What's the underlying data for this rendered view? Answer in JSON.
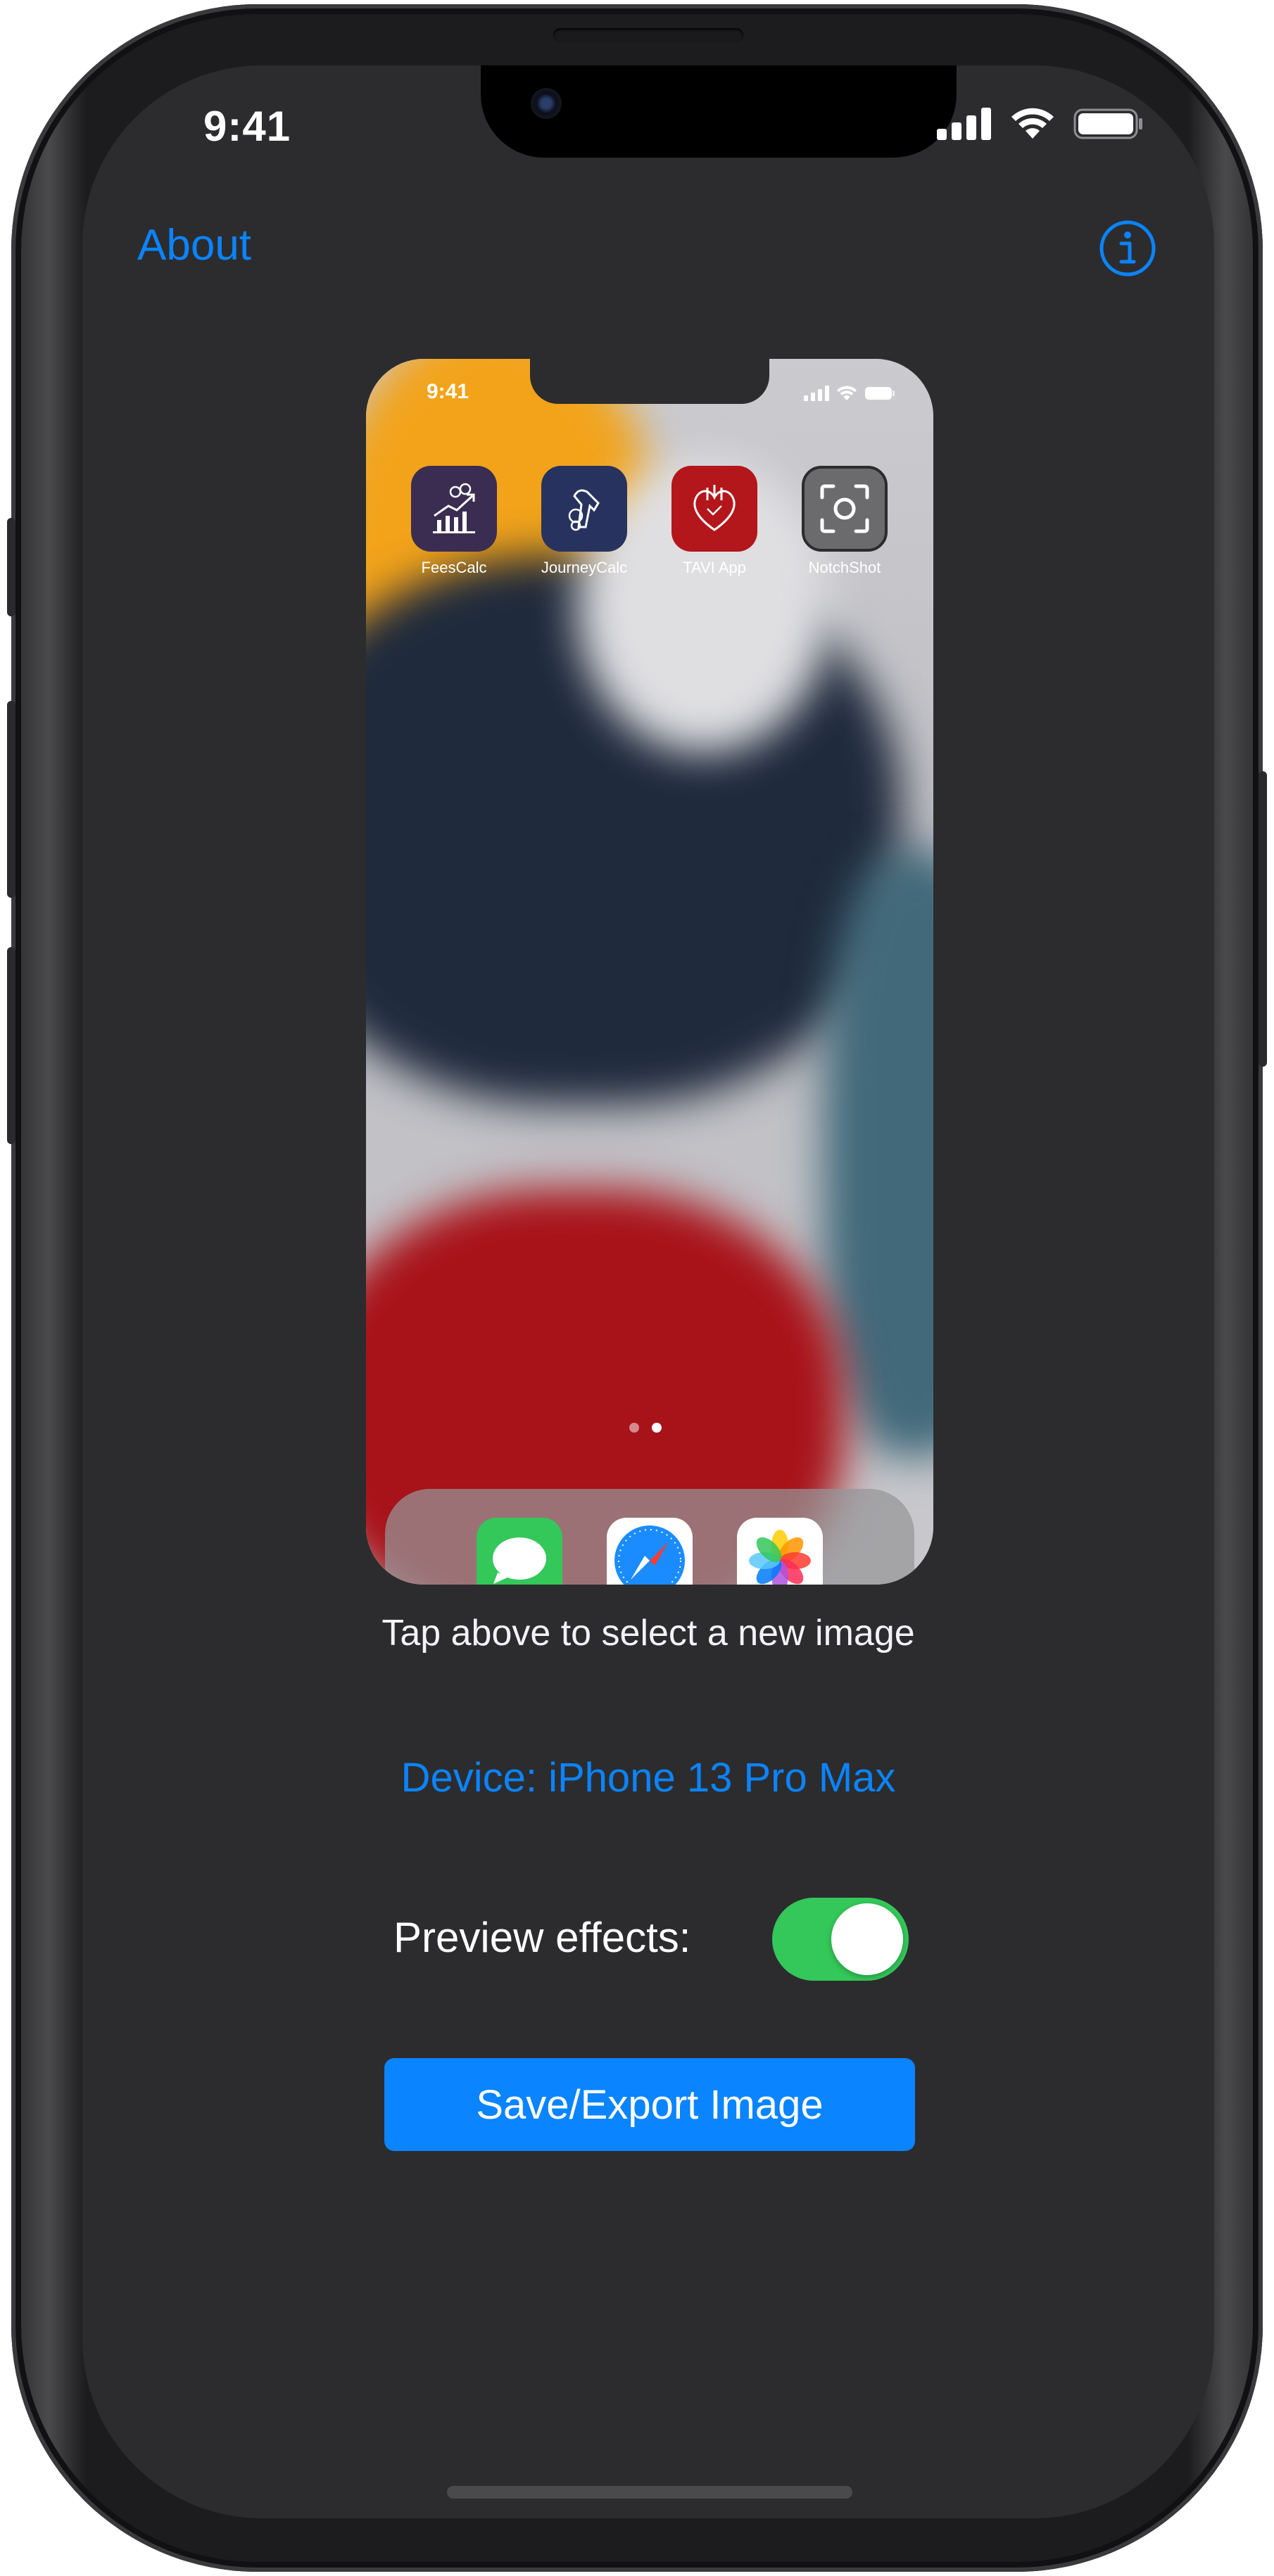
{
  "status_bar": {
    "time": "9:41"
  },
  "nav": {
    "about_label": "About",
    "info_icon": "info-circle-icon"
  },
  "preview": {
    "status_time": "9:41",
    "apps": [
      {
        "label": "FeesCalc",
        "icon": "chart-growth-icon",
        "color": "#3b2d52"
      },
      {
        "label": "JourneyCalc",
        "icon": "fuel-nozzle-icon",
        "color": "#27335e"
      },
      {
        "label": "TAVI App",
        "icon": "heart-icon",
        "color": "#b3161b"
      },
      {
        "label": "NotchShot",
        "icon": "screenshot-viewfinder-icon",
        "color": "#6b6b6d"
      }
    ],
    "dock_apps": [
      {
        "name": "Messages",
        "icon": "messages-icon",
        "color": "#34c759"
      },
      {
        "name": "Safari",
        "icon": "compass-icon",
        "color": "#ffffff"
      },
      {
        "name": "Photos",
        "icon": "photos-flower-icon",
        "color": "#ffffff"
      }
    ],
    "page_count": 2,
    "active_page": 2
  },
  "hint_text": "Tap above to select a new image",
  "device_label": "Device: iPhone 13 Pro Max",
  "preview_effects": {
    "label": "Preview effects:",
    "enabled": true
  },
  "save_button_label": "Save/Export Image",
  "colors": {
    "accent": "#0a84ff",
    "background": "#2c2c2e",
    "toggle_on": "#34c759"
  }
}
